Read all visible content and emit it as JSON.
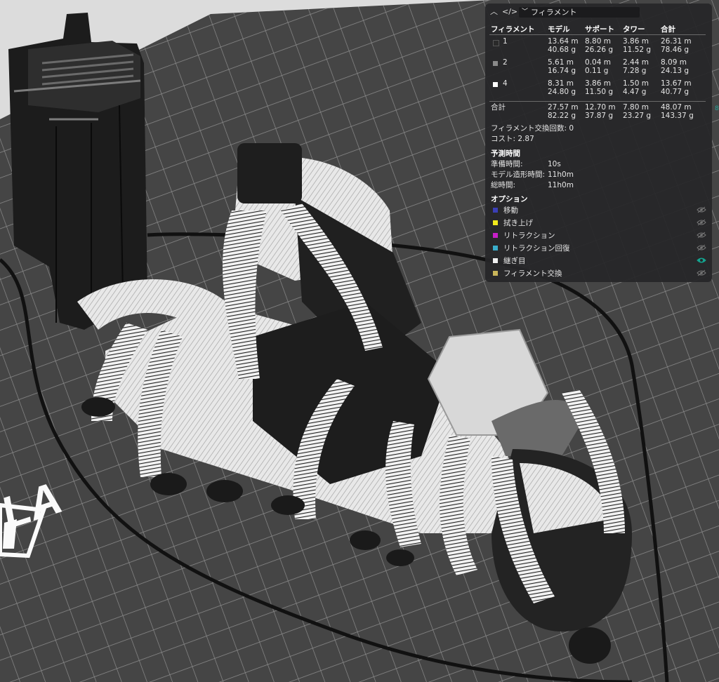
{
  "colors": {
    "filament_1": "#2a2a2a",
    "filament_2": "#8a8a8a",
    "filament_4": "#ffffff",
    "accent": "#14a38f"
  },
  "plate": {
    "logo_text": "FLA"
  },
  "panel": {
    "view_selector": "フィラメント",
    "headers": [
      "フィラメント",
      "モデル",
      "サポート",
      "タワー",
      "合計"
    ],
    "rows": [
      {
        "id": "1",
        "model": [
          "13.64 m",
          "40.68 g"
        ],
        "support": [
          "8.80 m",
          "26.26 g"
        ],
        "tower": [
          "3.86 m",
          "11.52 g"
        ],
        "total": [
          "26.31 m",
          "78.46 g"
        ]
      },
      {
        "id": "2",
        "model": [
          "5.61 m",
          "16.74 g"
        ],
        "support": [
          "0.04 m",
          "0.11 g"
        ],
        "tower": [
          "2.44 m",
          "7.28 g"
        ],
        "total": [
          "8.09 m",
          "24.13 g"
        ]
      },
      {
        "id": "4",
        "model": [
          "8.31 m",
          "24.80 g"
        ],
        "support": [
          "3.86 m",
          "11.50 g"
        ],
        "tower": [
          "1.50 m",
          "4.47 g"
        ],
        "total": [
          "13.67 m",
          "40.77 g"
        ]
      }
    ],
    "sum": {
      "label": "合計",
      "model": [
        "27.57 m",
        "82.22 g"
      ],
      "support": [
        "12.70 m",
        "37.87 g"
      ],
      "tower": [
        "7.80 m",
        "23.27 g"
      ],
      "total": [
        "48.07 m",
        "143.37 g"
      ]
    },
    "filament_changes": "フィラメント交換回数: 0",
    "cost": "コスト: 2.87",
    "estimate": {
      "title": "予測時間",
      "rows": [
        {
          "label": "準備時間:",
          "value": "10s"
        },
        {
          "label": "モデル造形時間:",
          "value": "11h0m"
        },
        {
          "label": "総時間:",
          "value": "11h0m"
        }
      ]
    },
    "options": {
      "title": "オプション",
      "items": [
        {
          "label": "移動",
          "color": "#3b3fb6",
          "visible": false
        },
        {
          "label": "拭き上げ",
          "color": "#f2ea1c",
          "visible": false
        },
        {
          "label": "リトラクション",
          "color": "#c81fc8",
          "visible": false
        },
        {
          "label": "リトラクション回復",
          "color": "#3aaecc",
          "visible": false
        },
        {
          "label": "継ぎ目",
          "color": "#f0f0f0",
          "visible": true
        },
        {
          "label": "フィラメント交換",
          "color": "#c9b55a",
          "visible": false
        }
      ]
    }
  },
  "edge_marker": "8"
}
